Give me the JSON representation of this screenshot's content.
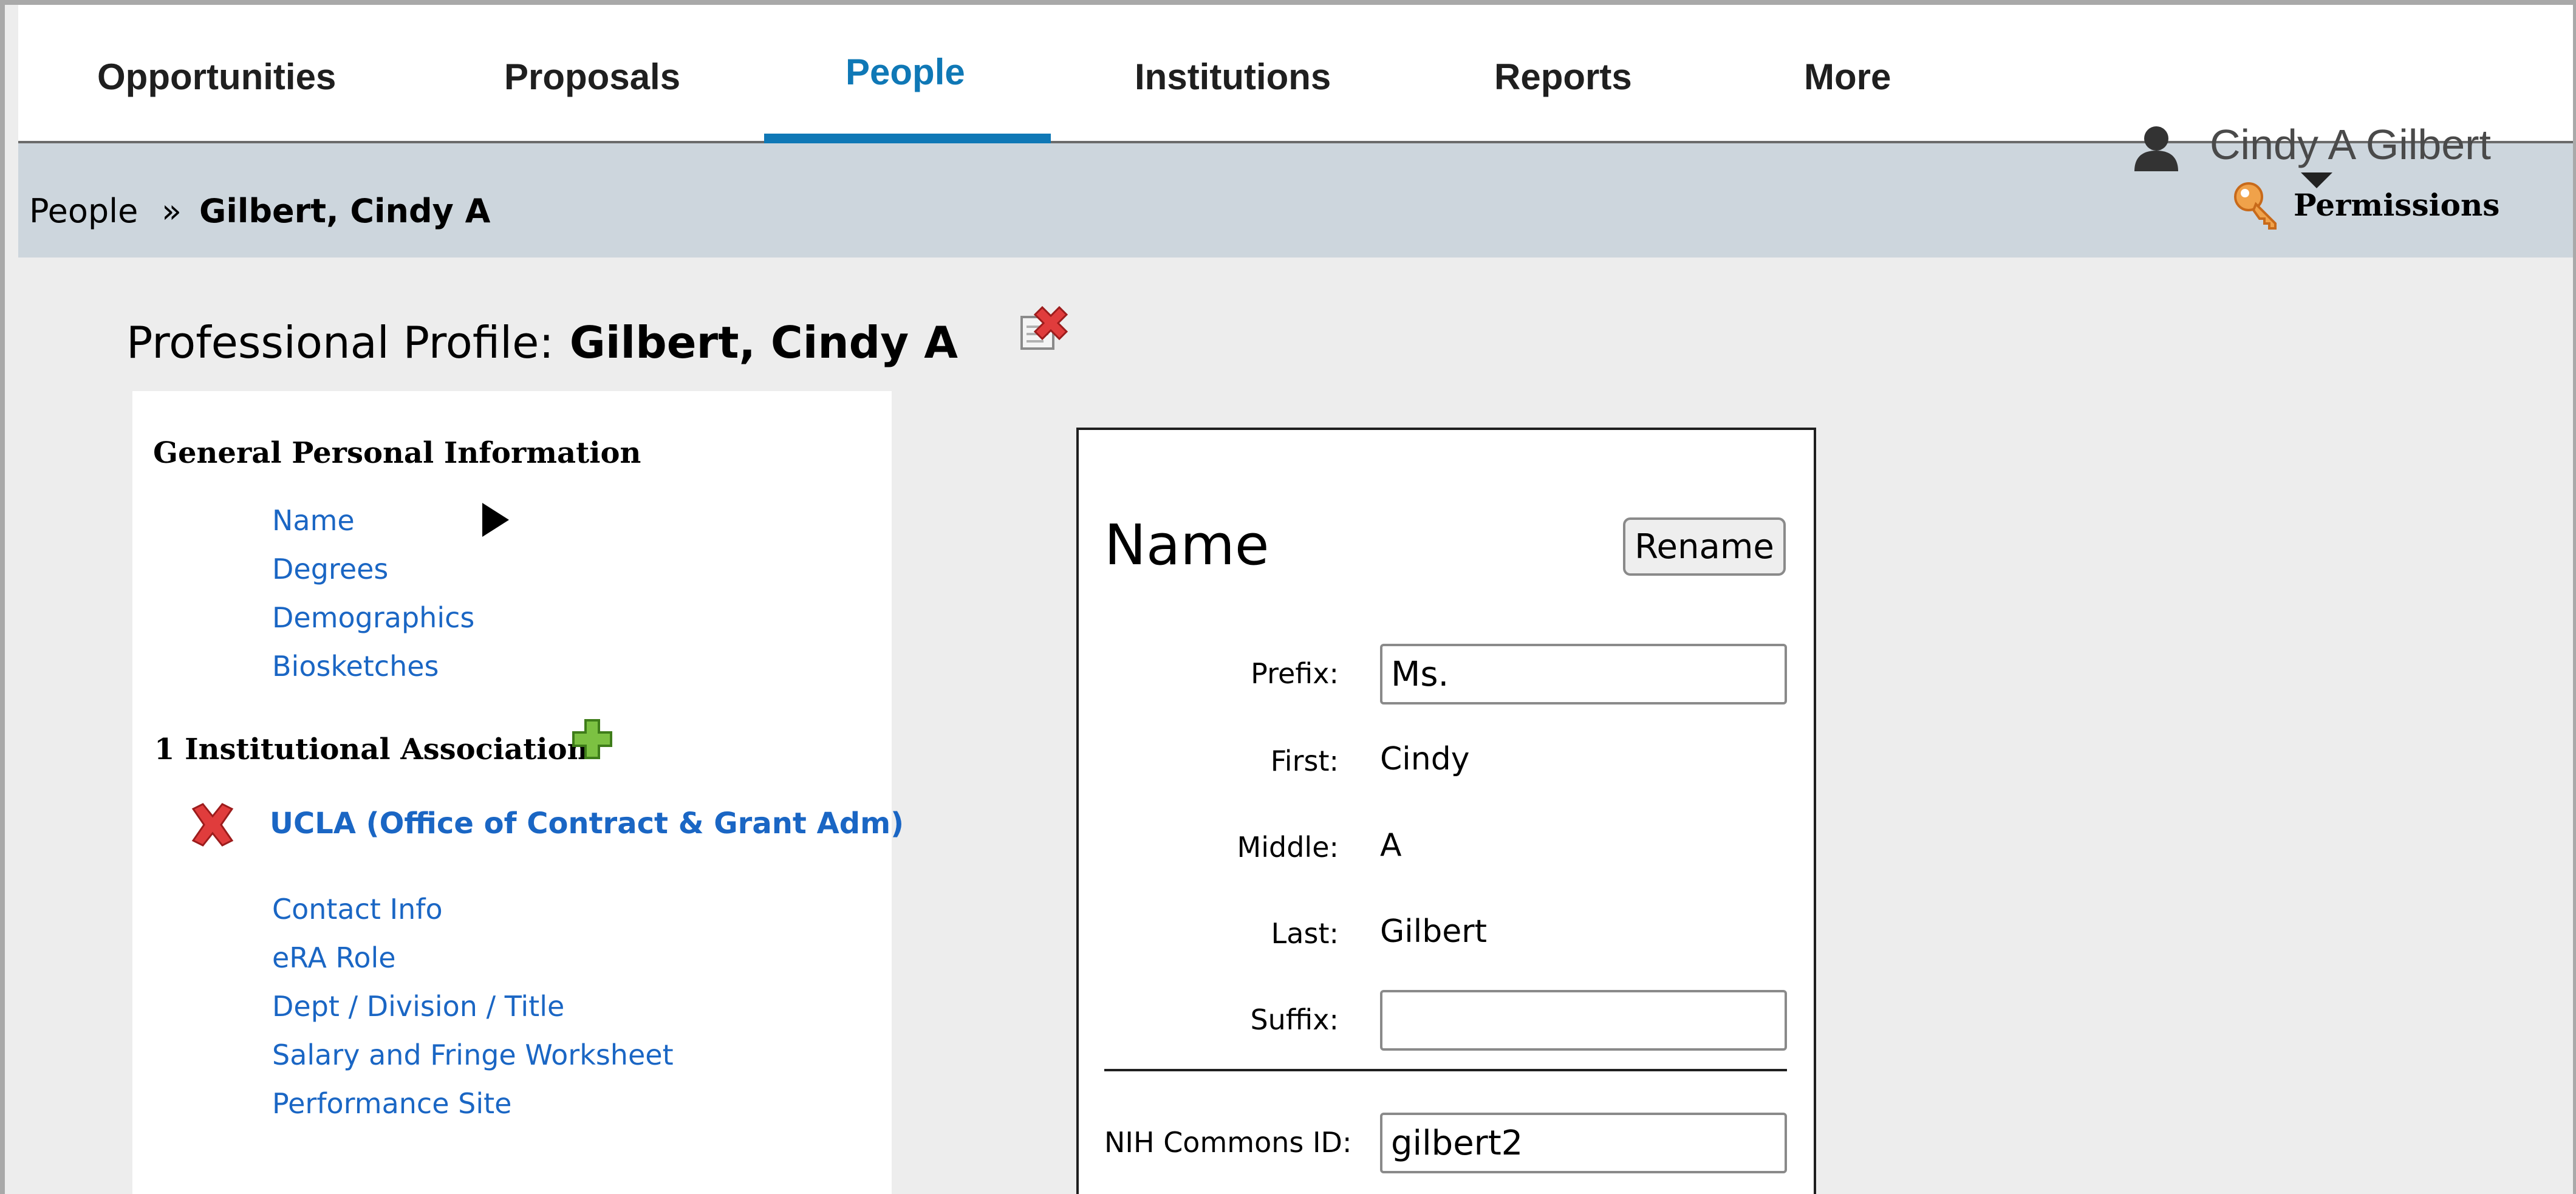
{
  "nav": {
    "tabs": [
      {
        "label": "Opportunities"
      },
      {
        "label": "Proposals"
      },
      {
        "label": "People",
        "active": true
      },
      {
        "label": "Institutions"
      },
      {
        "label": "Reports"
      },
      {
        "label": "More"
      }
    ],
    "accent_color": "#0f78b6"
  },
  "user": {
    "name": "Cindy A Gilbert",
    "icon": "user-icon",
    "permissions_label": "Permissions",
    "permissions_icon": "key-icon"
  },
  "breadcrumb": {
    "root": "People",
    "separator": "»",
    "current": "Gilbert, Cindy A"
  },
  "profile": {
    "title_prefix": "Professional Profile:",
    "person_name": "Gilbert, Cindy A",
    "delete_icon": "delete-profile-icon"
  },
  "sidebar": {
    "general_heading": "General Personal Information",
    "general_links": [
      {
        "label": "Name",
        "selected": true
      },
      {
        "label": "Degrees"
      },
      {
        "label": "Demographics"
      },
      {
        "label": "Biosketches"
      }
    ],
    "institution_heading": "1 Institutional Association",
    "institution_name": "UCLA (Office of Contract & Grant Adm)",
    "institution_links": [
      {
        "label": "Contact Info"
      },
      {
        "label": "eRA Role"
      },
      {
        "label": "Dept / Division / Title"
      },
      {
        "label": "Salary and Fringe Worksheet"
      },
      {
        "label": "Performance Site"
      }
    ]
  },
  "name_panel": {
    "heading": "Name",
    "rename_label": "Rename",
    "prefix_label": "Prefix:",
    "prefix_value": "Ms.",
    "first_label": "First:",
    "first_value": "Cindy",
    "middle_label": "Middle:",
    "middle_value": "A",
    "last_label": "Last:",
    "last_value": "Gilbert",
    "suffix_label": "Suffix:",
    "suffix_value": "",
    "nih_label": "NIH Commons ID:",
    "nih_value": "gilbert2"
  }
}
